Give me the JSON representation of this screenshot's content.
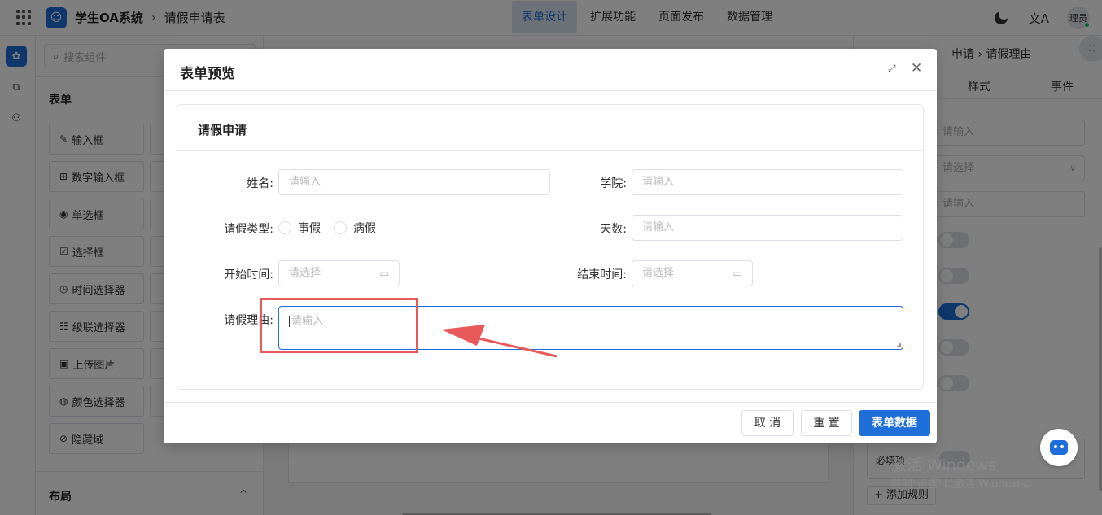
{
  "app": {
    "title": "学生OA系统",
    "breadcrumb_sep": "›",
    "page": "请假申请表",
    "nav": [
      {
        "label": "表单设计",
        "active": true
      },
      {
        "label": "扩展功能",
        "active": false
      },
      {
        "label": "页面发布",
        "active": false
      },
      {
        "label": "数据管理",
        "active": false
      }
    ],
    "translate_icon": "文A",
    "user": "理员"
  },
  "components": {
    "search_placeholder": "搜索组件",
    "section": "表单",
    "items": [
      {
        "icon": "✎",
        "label": "输入框"
      },
      {
        "icon": "⊞",
        "label": "数字输入框"
      },
      {
        "icon": "◉",
        "label": "单选框"
      },
      {
        "icon": "☑",
        "label": "选择框"
      },
      {
        "icon": "◷",
        "label": "时间选择器"
      },
      {
        "icon": "☷",
        "label": "级联选择器"
      },
      {
        "icon": "▣",
        "label": "上传图片"
      },
      {
        "icon": "◍",
        "label": "颜色选择器"
      },
      {
        "icon": "⊘",
        "label": "隐藏域"
      }
    ],
    "layout_section": "布局",
    "layout_chevron": "^"
  },
  "props": {
    "breadcrumb": "申请 › 请假理由",
    "tabs": [
      "样式",
      "事件"
    ],
    "fields": [
      {
        "placeholder": "请输入",
        "chevron": ""
      },
      {
        "placeholder": "请选择",
        "chevron": "∨"
      },
      {
        "placeholder": "请输入",
        "chevron": ""
      }
    ],
    "toggles": [
      false,
      false,
      true,
      false,
      false
    ],
    "required_label": "必填项",
    "add_rule": "+ 添加规则"
  },
  "watermark": {
    "line1": "激活 Windows",
    "line2": "转到\"设置\"以激活 Windows。"
  },
  "dialog": {
    "title": "表单预览",
    "maximize_icon": "⤢",
    "close_icon": "✕",
    "card_title": "请假申请",
    "fields": {
      "name": {
        "label": "姓名:",
        "placeholder": "请输入"
      },
      "college": {
        "label": "学院:",
        "placeholder": "请输入"
      },
      "leave_type": {
        "label": "请假类型:",
        "options": [
          "事假",
          "病假"
        ]
      },
      "days": {
        "label": "天数:",
        "placeholder": "请输入"
      },
      "start_time": {
        "label": "开始时间:",
        "placeholder": "请选择"
      },
      "end_time": {
        "label": "结束时间:",
        "placeholder": "请选择"
      },
      "reason": {
        "label": "请假理由:",
        "placeholder": "请输入"
      }
    },
    "calendar_icon": "▭",
    "buttons": {
      "cancel": "取 消",
      "reset": "重 置",
      "submit": "表单数据"
    }
  },
  "colors": {
    "accent": "#1e6fd9",
    "annotation": "#e85a5a"
  }
}
